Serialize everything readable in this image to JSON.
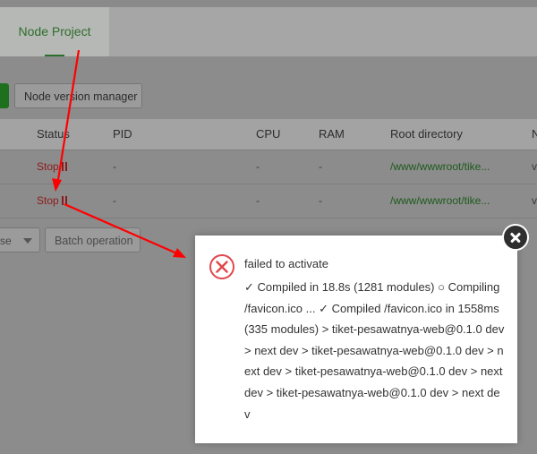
{
  "tabs": [
    {
      "label": "Node Project",
      "active": true
    }
  ],
  "toolbar": {
    "nvm_label": "Node version manager"
  },
  "table": {
    "headers": {
      "status": "Status",
      "pid": "PID",
      "cpu": "CPU",
      "ram": "RAM",
      "root": "Root directory",
      "cut": "N"
    },
    "rows": [
      {
        "status": "Stop",
        "pid": "-",
        "cpu": "-",
        "ram": "-",
        "root": "/www/wwwroot/tike...",
        "cut": "v"
      },
      {
        "status": "Stop",
        "pid": "-",
        "cpu": "-",
        "ram": "-",
        "root": "/www/wwwroot/tike...",
        "cut": "v"
      }
    ]
  },
  "bottom": {
    "select_value": "se",
    "batch_label": "Batch operation"
  },
  "dialog": {
    "title": "failed to activate",
    "message": "✓ Compiled in 18.8s (1281 modules) ○ Compiling /favicon.ico ... ✓ Compiled /favicon.ico in 1558ms (335 modules) > tiket-pesawatnya-web@0.1.0 dev > next dev > tiket-pesawatnya-web@0.1.0 dev > next dev > tiket-pesawatnya-web@0.1.0 dev > next dev > tiket-pesawatnya-web@0.1.0 dev > next dev"
  },
  "colors": {
    "accent": "#2e6e2c",
    "stop": "#8b1b1b",
    "error": "#e0474c",
    "arrow": "#ff0000",
    "overlay": "#8c8c8c"
  },
  "icons": [
    "close-icon",
    "error-icon",
    "pause-icon",
    "chevron-down-icon"
  ]
}
